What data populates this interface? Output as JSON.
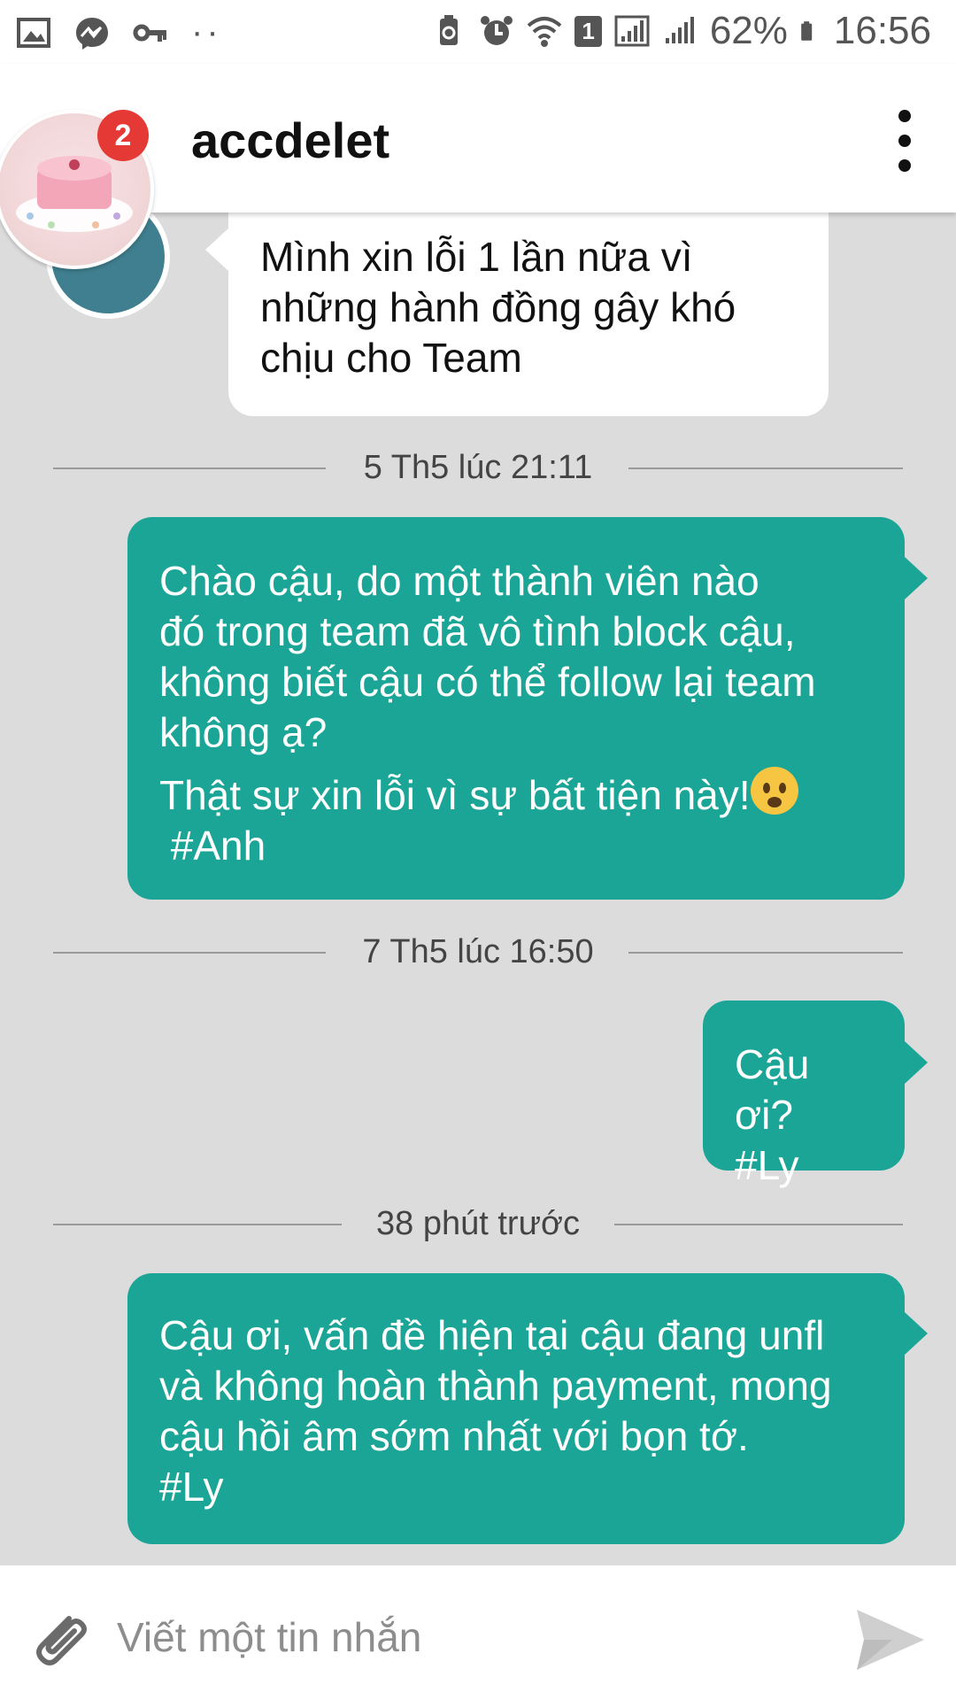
{
  "status_bar": {
    "sim_badge": "1",
    "battery": "62%",
    "time": "16:56"
  },
  "header": {
    "title": "accdelet",
    "badge_count": "2"
  },
  "messages": [
    {
      "type": "incoming",
      "lines": [
        "Mình xin lỗi 1 lần nữa vì",
        "những hành đồng gây khó",
        "chịu cho Team"
      ]
    },
    {
      "type": "timestamp",
      "text": "5 Th5 lúc 21:11"
    },
    {
      "type": "outgoing",
      "lines": [
        "Chào cậu, do một thành viên nào",
        "đó trong team đã vô tình block cậu,",
        "không biết cậu có thể follow lại team",
        "không ạ?",
        "Thật sự xin lỗi vì sự bất tiện này!",
        " #Anh"
      ]
    },
    {
      "type": "timestamp",
      "text": "7 Th5 lúc 16:50"
    },
    {
      "type": "outgoing",
      "lines": [
        "Cậu ơi?",
        "#Ly"
      ]
    },
    {
      "type": "timestamp",
      "text": "38 phút trước"
    },
    {
      "type": "outgoing",
      "lines": [
        "Cậu ơi, vấn đề hiện tại cậu đang unfl",
        "và không hoàn thành payment, mong",
        "cậu hồi âm sớm nhất với bọn tớ.",
        "#Ly"
      ]
    }
  ],
  "composer": {
    "placeholder": "Viết một tin nhắn"
  },
  "colors": {
    "outgoing_bubble": "#1aa596",
    "badge": "#e53935"
  }
}
